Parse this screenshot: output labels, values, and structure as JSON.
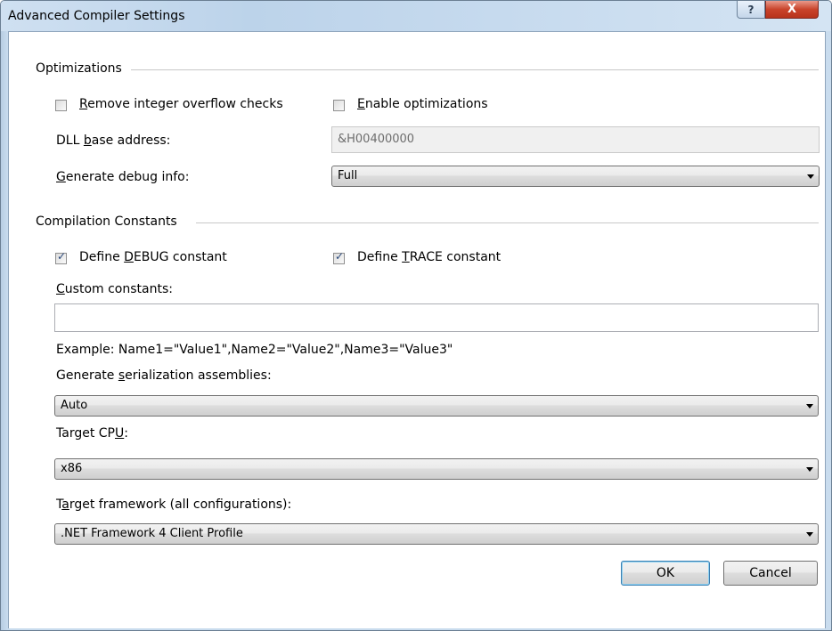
{
  "window": {
    "title": "Advanced Compiler Settings",
    "help_glyph": "?",
    "close_glyph": "X"
  },
  "optimizations": {
    "group_label": "Optimizations",
    "remove_overflow": {
      "pre": "",
      "mnemonic": "R",
      "post": "emove integer overflow checks",
      "checked": false
    },
    "enable_opt": {
      "pre": "",
      "mnemonic": "E",
      "post": "nable optimizations",
      "checked": false
    },
    "dll_base": {
      "label_pre": "DLL ",
      "mnemonic": "b",
      "label_post": "ase address:",
      "value": "&H00400000"
    },
    "debug_info": {
      "label_pre": "",
      "mnemonic": "G",
      "label_post": "enerate debug info:",
      "value": "Full"
    }
  },
  "constants": {
    "group_label": "Compilation Constants",
    "define_debug": {
      "pre": "Define ",
      "mnemonic": "D",
      "post": "EBUG constant",
      "checked": true
    },
    "define_trace": {
      "pre": "Define ",
      "mnemonic": "T",
      "post": "RACE constant",
      "checked": true
    },
    "custom": {
      "label_pre": "",
      "mnemonic": "C",
      "label_post": "ustom constants:",
      "value": ""
    },
    "example": "Example: Name1=\"Value1\",Name2=\"Value2\",Name3=\"Value3\"",
    "serialization": {
      "label_pre": "Generate ",
      "mnemonic": "s",
      "label_post": "erialization assemblies:",
      "value": "Auto"
    },
    "target_cpu": {
      "label_pre": "Target CP",
      "mnemonic": "U",
      "label_post": ":",
      "value": "x86"
    },
    "target_framework": {
      "label_pre": "T",
      "mnemonic": "a",
      "label_post": "rget framework (all configurations):",
      "value": ".NET Framework 4 Client Profile"
    }
  },
  "buttons": {
    "ok": "OK",
    "cancel": "Cancel"
  }
}
